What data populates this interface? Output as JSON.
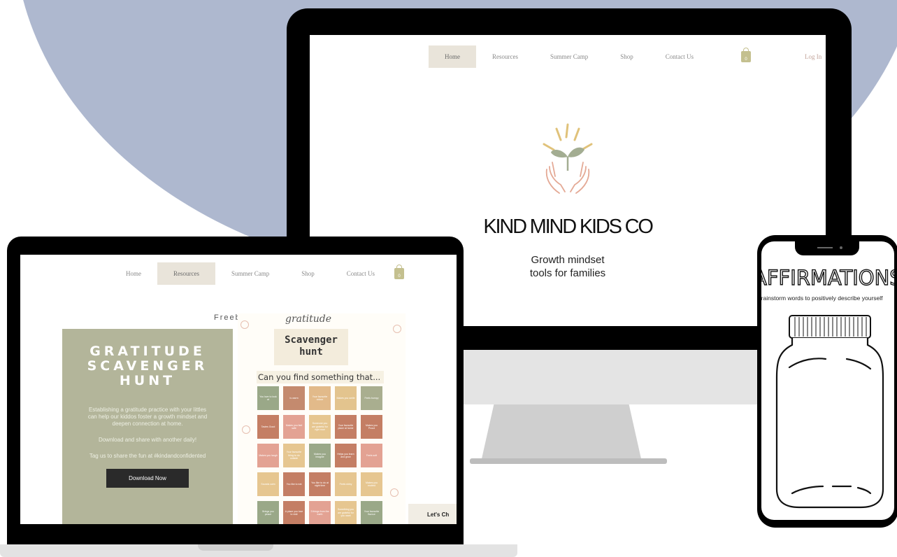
{
  "monitor_site": {
    "nav": [
      "Home",
      "Resources",
      "Summer Camp",
      "Shop",
      "Contact Us"
    ],
    "active_nav": "Home",
    "cart_count": "0",
    "login": "Log In",
    "brand": "KIND MIND KIDS CO",
    "tagline_line1": "Growth mindset",
    "tagline_line2": "tools for families"
  },
  "laptop_site": {
    "nav": [
      "Home",
      "Resources",
      "Summer Camp",
      "Shop",
      "Contact Us"
    ],
    "active_nav": "Resources",
    "cart_count": "0",
    "section_title": "Freebies",
    "card": {
      "title_line1": "GRATITUDE",
      "title_line2": "SCAVENGER",
      "title_line3": "HUNT",
      "para1": "Establishing a gratitude practice with your littles can help our kiddos foster a growth mindset and deepen connection at home.",
      "para2": "Download and share with another daily!",
      "para3": "Tag us to share the fun at #kindandconfidented",
      "button": "Download Now"
    },
    "worksheet": {
      "script_text": "gratitude",
      "title_line1": "Scavenger",
      "title_line2": "hunt",
      "question": "Can you find something that...",
      "cells": [
        {
          "text": "You love to look at",
          "color": "#9aa888"
        },
        {
          "text": "Is warm",
          "color": "#c48a6e"
        },
        {
          "text": "Your favourite colour",
          "color": "#e2ba8a"
        },
        {
          "text": "Makes you smile",
          "color": "#e3c48e"
        },
        {
          "text": "Feels bumpy",
          "color": "#a9ae8f"
        },
        {
          "text": "Tastes Good",
          "color": "#c47e64"
        },
        {
          "text": "Makes you feel safe",
          "color": "#e3a293"
        },
        {
          "text": "Someone you are grateful for right now",
          "color": "#e6c690"
        },
        {
          "text": "Your favourite place at home",
          "color": "#c47e64"
        },
        {
          "text": "Makes you Proud",
          "color": "#c47e64"
        },
        {
          "text": "Makes you laugh",
          "color": "#e3a293"
        },
        {
          "text": "Your favourite thing to do outside",
          "color": "#e6c690"
        },
        {
          "text": "Makes you imagine",
          "color": "#9aa888"
        },
        {
          "text": "Helps you learn and grow",
          "color": "#c47e64"
        },
        {
          "text": "Feels soft",
          "color": "#e3a293"
        },
        {
          "text": "Sounds calm",
          "color": "#e6c690"
        },
        {
          "text": "You like to eat",
          "color": "#c47e64"
        },
        {
          "text": "You like to do at night time",
          "color": "#c47e64"
        },
        {
          "text": "Feels shiny",
          "color": "#e6c690"
        },
        {
          "text": "Makes you excited",
          "color": "#e6c690"
        },
        {
          "text": "Brings you peace",
          "color": "#9aa888"
        },
        {
          "text": "A place you love to visit",
          "color": "#c47e64"
        },
        {
          "text": "3 things from the earth",
          "color": "#e3a293"
        },
        {
          "text": "Something you are grateful for you want",
          "color": "#e6c690"
        },
        {
          "text": "Your favourite flavour",
          "color": "#9aa888"
        }
      ]
    },
    "chat_label": "Let's Ch"
  },
  "phone": {
    "title": "AFFIRMATIONS",
    "subtitle": "Brainstorm words to positively describe yourself"
  },
  "colors": {
    "background_circle": "#aeb8cf",
    "sage": "#b3b59a",
    "nav_active": "#e9e4da",
    "bag": "#c4c08f"
  }
}
